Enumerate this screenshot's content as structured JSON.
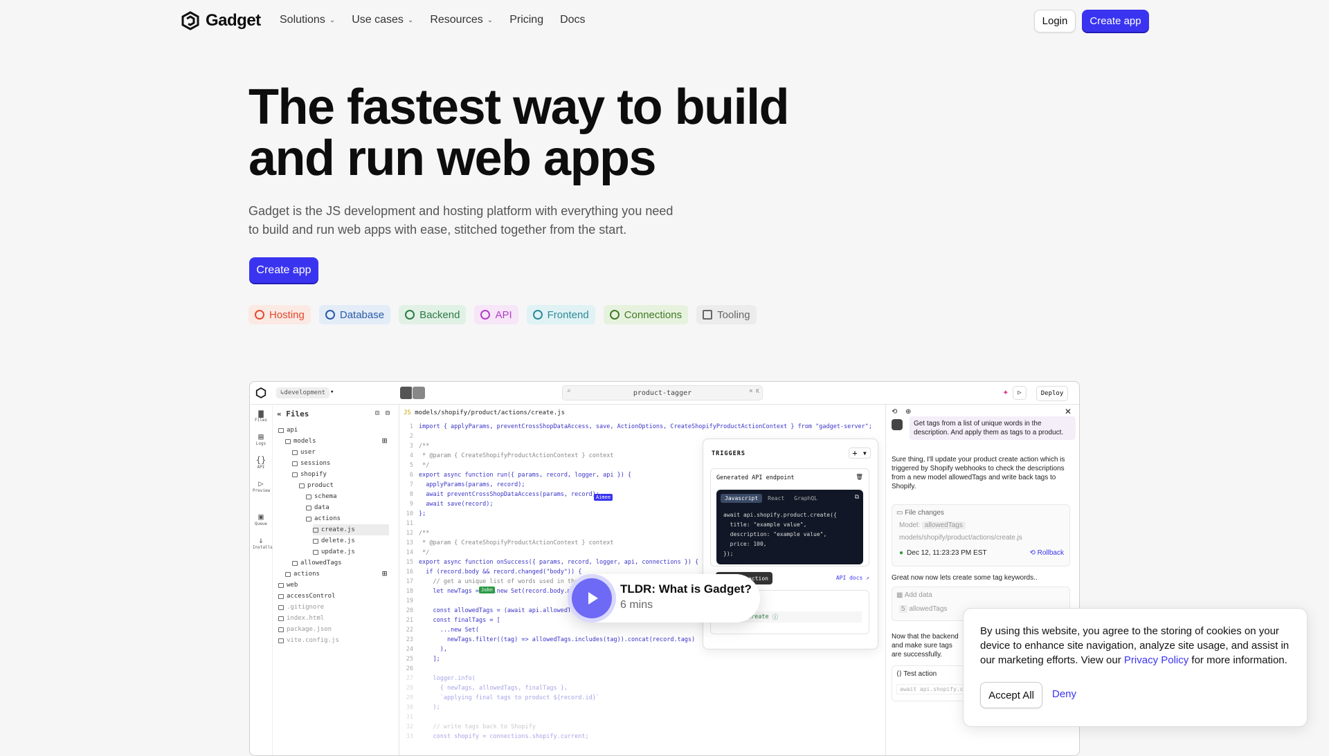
{
  "nav": {
    "brand": "Gadget",
    "menu": [
      {
        "label": "Solutions",
        "dropdown": true
      },
      {
        "label": "Use cases",
        "dropdown": true
      },
      {
        "label": "Resources",
        "dropdown": true
      },
      {
        "label": "Pricing",
        "dropdown": false
      },
      {
        "label": "Docs",
        "dropdown": false
      }
    ],
    "login": "Login",
    "create": "Create app"
  },
  "hero": {
    "title_line1": "The fastest way to build",
    "title_line2": "and run web apps",
    "subtitle": "Gadget is the JS development and hosting platform with everything you need to build and run web apps with ease, stitched together from the start.",
    "cta": "Create app"
  },
  "chips": [
    {
      "label": "Hosting",
      "color": "#e24a2d",
      "bg": "#fbe9e4"
    },
    {
      "label": "Database",
      "color": "#2a5aa8",
      "bg": "#e3ecf7"
    },
    {
      "label": "Backend",
      "color": "#2c7a46",
      "bg": "#e1f1e5"
    },
    {
      "label": "API",
      "color": "#b13fc7",
      "bg": "#f6e6f8"
    },
    {
      "label": "Frontend",
      "color": "#2c8a98",
      "bg": "#e0f2f4"
    },
    {
      "label": "Connections",
      "color": "#3f7a24",
      "bg": "#e6f2de"
    },
    {
      "label": "Tooling",
      "color": "#666666",
      "bg": "#ececec"
    }
  ],
  "app": {
    "env": "development",
    "search": "product-tagger",
    "search_kbd": "⌘ K",
    "deploy": "Deploy",
    "rail": [
      "Files",
      "Logs",
      "API",
      "Preview",
      "Queue",
      "Installs"
    ],
    "files_title": "Files",
    "files": [
      {
        "name": "api",
        "depth": 0
      },
      {
        "name": "models",
        "depth": 1
      },
      {
        "name": "user",
        "depth": 2
      },
      {
        "name": "sessions",
        "depth": 2
      },
      {
        "name": "shopify",
        "depth": 2
      },
      {
        "name": "product",
        "depth": 3
      },
      {
        "name": "schema",
        "depth": 4
      },
      {
        "name": "data",
        "depth": 4
      },
      {
        "name": "actions",
        "depth": 4
      },
      {
        "name": "create.js",
        "depth": 5
      },
      {
        "name": "delete.js",
        "depth": 5
      },
      {
        "name": "update.js",
        "depth": 5
      },
      {
        "name": "allowedTags",
        "depth": 2
      },
      {
        "name": "actions",
        "depth": 1
      },
      {
        "name": "web",
        "depth": 0
      },
      {
        "name": "accessControl",
        "depth": 0
      },
      {
        "name": ".gitignore",
        "depth": 0
      },
      {
        "name": "index.html",
        "depth": 0
      },
      {
        "name": "package.json",
        "depth": 0
      },
      {
        "name": "vite.config.js",
        "depth": 0
      }
    ],
    "editor_path": "models/shopify/product/actions/create.js",
    "code": [
      "import { applyParams, preventCrossShopDataAccess, save, ActionOptions, CreateShopifyProductActionContext } from \"gadget-server\";",
      "",
      "/**",
      " * @param { CreateShopifyProductActionContext } context",
      " */",
      "export async function run({ params, record, logger, api }) {",
      "  applyParams(params, record);",
      "  await preventCrossShopDataAccess(params, record);",
      "  await save(record);",
      "};",
      "",
      "/**",
      " * @param { CreateShopifyProductActionContext } context",
      " */",
      "export async function onSuccess({ params, record, logger, api, connections }) {",
      "  if (record.body && record.changed(\"body\")) {",
      "    // get a unique list of words used in the",
      "    let newTags = [...new Set(record.body.m",
      "",
      "    const allowedTags = (await api.allowedTag",
      "    const finalTags = [",
      "      ...new Set(",
      "        newTags.filter((tag) => allowedTags.includes(tag)).concat(record.tags)",
      "      ),",
      "    ];",
      "",
      "    logger.info(",
      "      { newTags, allowedTags, finalTags },",
      "      `applying final tags to product ${record.id}`",
      "    );",
      "",
      "    // write tags back to Shopify",
      "    const shopify = connections.shopify.current;"
    ],
    "cursor_aimee": "Aimee",
    "cursor_john": "John",
    "triggers": {
      "title": "TRIGGERS",
      "endpoint_title": "Generated API endpoint",
      "tabs": [
        "Javascript",
        "React",
        "GraphQL"
      ],
      "code": [
        "await api.shopify.product.create({",
        "  title: \"example value\",",
        "  description: \"example value\",",
        "  price: 100,",
        "});"
      ],
      "action_btn": "action",
      "api_docs": "API docs",
      "webhook": "ok",
      "route": "product/create"
    },
    "assistant": {
      "prompt": "Get tags from a list of unique words in the description. And apply them as tags to a product.",
      "reply1": "Sure thing, I'll update your product create action which is triggered by Shopify webhooks to check the descriptions from a new model allowedTags and write back tags to Shopify.",
      "file_changes": "File changes",
      "model_label": "Model:",
      "model_value": "allowedTags",
      "file_path": "models/shopify/product/actions/create.js",
      "timestamp": "Dec 12, 11:23:23 PM EST",
      "rollback": "Rollback",
      "reply2": "Great now now lets create some tag keywords..",
      "add_data": "Add data",
      "add_data_count": "5",
      "add_data_model": "allowedTags",
      "reply3": "Now that the backend and make sure tags are successfully.",
      "test_action": "Test action",
      "test_code": "await api.shopify.c"
    }
  },
  "tldr": {
    "title": "TLDR: What is Gadget?",
    "duration": "6 mins"
  },
  "cookie": {
    "text_before": "By using this website, you agree to the storing of cookies on your device to enhance site navigation, analyze site usage, and assist in our marketing efforts. View our ",
    "link": "Privacy Policy",
    "text_after": " for more information.",
    "accept": "Accept All",
    "deny": "Deny"
  }
}
